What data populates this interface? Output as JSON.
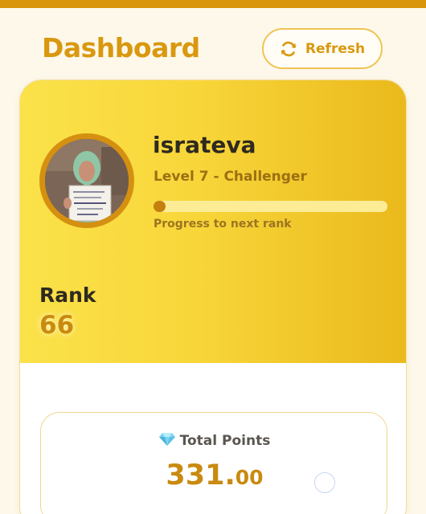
{
  "header": {
    "title": "Dashboard",
    "refresh_label": "Refresh",
    "refresh_icon": "refresh-icon"
  },
  "profile": {
    "username": "israteva",
    "level": "Level 7 - Challenger",
    "progress_fraction": 0.05,
    "progress_label": "Progress to next rank",
    "rank_label": "Rank",
    "rank_value": "66"
  },
  "points": {
    "icon": "diamond-icon",
    "label": "Total Points",
    "value_int": "331.",
    "value_dec": "00"
  },
  "colors": {
    "accent": "#d9980f",
    "hero_start": "#fbe24a",
    "hero_end": "#eab91c",
    "progress_fill": "#c47f0d"
  }
}
